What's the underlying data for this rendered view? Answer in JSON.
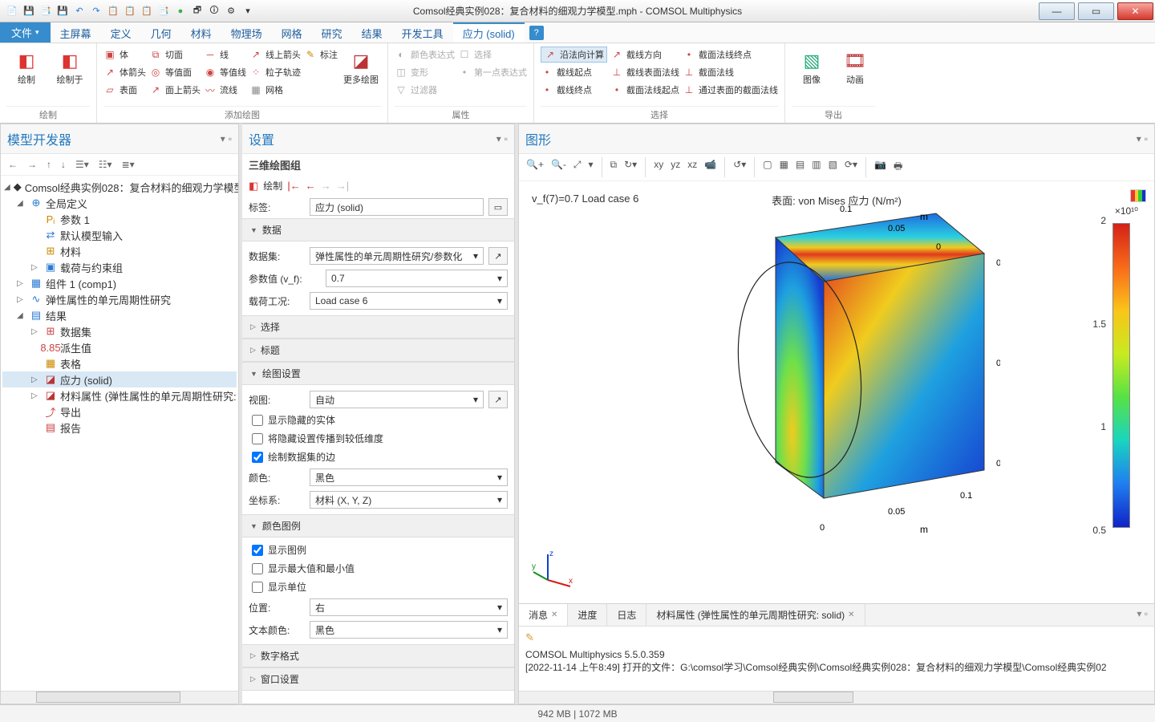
{
  "window": {
    "title": "Comsol经典实例028：复合材料的细观力学模型.mph - COMSOL Multiphysics",
    "min": "—",
    "max": "▭",
    "close": "✕"
  },
  "qat": {
    "icons": [
      "📄",
      "💾",
      "📑",
      "💾",
      "↶",
      "↷",
      "📋",
      "📋",
      "📋",
      "📑",
      "🟢",
      "🗗",
      "🛈",
      "⚙",
      "▾"
    ]
  },
  "menu": {
    "file": "文件",
    "items": [
      "主屏幕",
      "定义",
      "几何",
      "材料",
      "物理场",
      "网格",
      "研究",
      "结果",
      "开发工具",
      "应力 (solid)"
    ],
    "activeIndex": 9,
    "help": "?"
  },
  "ribbon": {
    "groups": {
      "plot": {
        "label": "绘制",
        "items": [
          "绘制",
          "绘制于"
        ]
      },
      "add": {
        "label": "添加绘图",
        "col1": [
          "体",
          "体箭头",
          "表面"
        ],
        "col2": [
          "切面",
          "等值面",
          "面上箭头"
        ],
        "col3": [
          "线",
          "等值线",
          "流线"
        ],
        "col4": [
          "线上箭头",
          "粒子轨迹",
          "网格"
        ],
        "col5": [
          "标注",
          "",
          ""
        ],
        "more": "更多绘图"
      },
      "attr": {
        "label": "属性",
        "items": [
          "颜色表达式",
          "变形",
          "过滤器"
        ],
        "items2": [
          "选择",
          "第一点表达式",
          ""
        ]
      },
      "select": {
        "label": "选择",
        "col1": [
          "沿法向计算",
          "截线起点",
          "截线终点"
        ],
        "col2": [
          "截线方向",
          "截线表面法线",
          "截面法线起点"
        ],
        "col3": [
          "截面法线终点",
          "截面法线",
          "通过表面的截面法线"
        ]
      },
      "export": {
        "label": "导出",
        "items": [
          "图像",
          "动画"
        ]
      }
    }
  },
  "modelTree": {
    "title": "模型开发器",
    "nodes": {
      "root": "Comsol经典实例028：复合材料的细观力学模型",
      "globalDef": "全局定义",
      "params": "参数 1",
      "defaultInput": "默认模型输入",
      "materials": "材料",
      "loadGroup": "载荷与约束组",
      "comp1": "组件 1  (comp1)",
      "study": "弹性属性的单元周期性研究",
      "results": "结果",
      "datasets": "数据集",
      "derived": "派生值",
      "tables": "表格",
      "stress": "应力 (solid)",
      "matProp": "材料属性 (弹性属性的单元周期性研究:",
      "export": "导出",
      "report": "报告"
    }
  },
  "settings": {
    "title": "设置",
    "subtitle": "三维绘图组",
    "plotBtn": "绘制",
    "label": {
      "lbl": "标签:",
      "val": "应力 (solid)"
    },
    "sections": {
      "data": "数据",
      "select": "选择",
      "titleSec": "标题",
      "plotSettings": "绘图设置",
      "legend": "颜色图例",
      "numFmt": "数字格式",
      "winSet": "窗口设置"
    },
    "data": {
      "datasetLbl": "数据集:",
      "datasetVal": "弹性属性的单元周期性研究/参数化",
      "paramLbl": "参数值 (v_f):",
      "paramVal": "0.7",
      "loadLbl": "载荷工况:",
      "loadVal": "Load case 6"
    },
    "plotset": {
      "viewLbl": "视图:",
      "viewVal": "自动",
      "chk1": "显示隐藏的实体",
      "chk2": "将隐藏设置传播到较低维度",
      "chk3": "绘制数据集的边",
      "colorLbl": "颜色:",
      "colorVal": "黑色",
      "coordLbl": "坐标系:",
      "coordVal": "材料  (X, Y, Z)"
    },
    "legend": {
      "chk1": "显示图例",
      "chk2": "显示最大值和最小值",
      "chk3": "显示单位",
      "posLbl": "位置:",
      "posVal": "右",
      "txtColorLbl": "文本颜色:",
      "txtColorVal": "黑色"
    }
  },
  "graphics": {
    "title": "图形",
    "plotInfo": "v_f(7)=0.7 Load case 6",
    "surfTitle": "表面: von Mises 应力 (N/m²)",
    "exp": "×10¹⁰",
    "legendVals": [
      "2",
      "1.5",
      "1",
      "0.5"
    ],
    "axisLabels": {
      "x": "x",
      "y": "y",
      "z": "z"
    },
    "axisTicks": [
      "0",
      "0.05",
      "0.1"
    ],
    "unit": "m"
  },
  "bottom": {
    "tabs": [
      "消息",
      "进度",
      "日志",
      "材料属性 (弹性属性的单元周期性研究: solid)"
    ],
    "activeTab": 0,
    "line1": "COMSOL Multiphysics 5.5.0.359",
    "line2": "[2022-11-14 上午8:49] 打开的文件：G:\\comsol学习\\Comsol经典实例\\Comsol经典实例028：复合材料的细观力学模型\\Comsol经典实例02"
  },
  "status": {
    "mem": "942 MB | 1072 MB"
  }
}
